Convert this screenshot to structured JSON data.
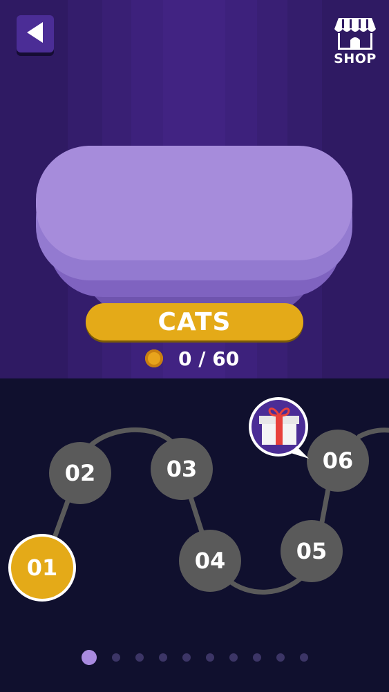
{
  "header": {
    "back_icon": "back-arrow-icon",
    "shop_icon": "storefront-icon",
    "shop_label": "SHOP"
  },
  "category": {
    "title": "CATS",
    "coin_icon": "coin-icon",
    "score_text": "0 / 60"
  },
  "levels": [
    {
      "label": "01",
      "state": "current"
    },
    {
      "label": "02",
      "state": "locked"
    },
    {
      "label": "03",
      "state": "locked"
    },
    {
      "label": "04",
      "state": "locked"
    },
    {
      "label": "05",
      "state": "locked"
    },
    {
      "label": "06",
      "state": "locked"
    }
  ],
  "gift_icon": "gift-box-icon",
  "pagination": {
    "total_pages": 10,
    "current_page": 1
  },
  "colors": {
    "accent_yellow": "#e4aa18",
    "card_purple": "#a68cdb",
    "background_top": "#2f1a63",
    "background_bottom": "#10102e",
    "node_gray": "#5a5a5a"
  }
}
